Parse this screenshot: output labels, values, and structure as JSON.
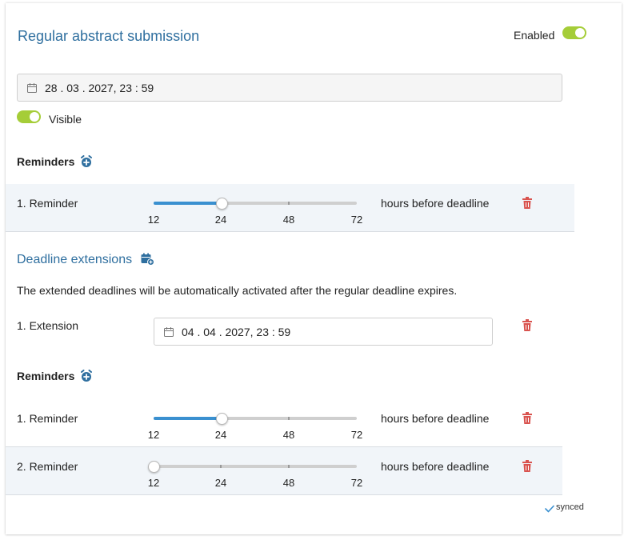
{
  "header": {
    "title": "Regular abstract submission",
    "enabled_label": "Enabled",
    "enabled": true
  },
  "deadline": {
    "value": "28 . 03 . 2027, 23 : 59"
  },
  "visibility": {
    "label": "Visible",
    "on": true
  },
  "reminders_section": {
    "label": "Reminders",
    "icon": "alarm-plus-icon",
    "items": [
      {
        "label": "1. Reminder",
        "value": 24,
        "suffix": "hours before deadline",
        "ticks": [
          "12",
          "24",
          "48",
          "72"
        ]
      }
    ]
  },
  "extensions": {
    "title": "Deadline extensions",
    "icon": "calendar-plus-icon",
    "description": "The extended deadlines will be automatically activated after the regular deadline expires.",
    "items": [
      {
        "label": "1. Extension",
        "date": "04 . 04 . 2027, 23 : 59",
        "reminders_label": "Reminders",
        "reminders": [
          {
            "label": "1. Reminder",
            "value": 24,
            "suffix": "hours before deadline",
            "ticks": [
              "12",
              "24",
              "48",
              "72"
            ]
          },
          {
            "label": "2. Reminder",
            "value": 12,
            "suffix": "hours before deadline",
            "ticks": [
              "12",
              "24",
              "48",
              "72"
            ]
          }
        ]
      }
    ]
  },
  "status": {
    "label": "synced",
    "icon": "check-icon"
  },
  "colors": {
    "accent": "#2f6f9f",
    "toggle_on": "#a5cd38",
    "slider_fill": "#3a90d0",
    "delete": "#d9534f"
  }
}
